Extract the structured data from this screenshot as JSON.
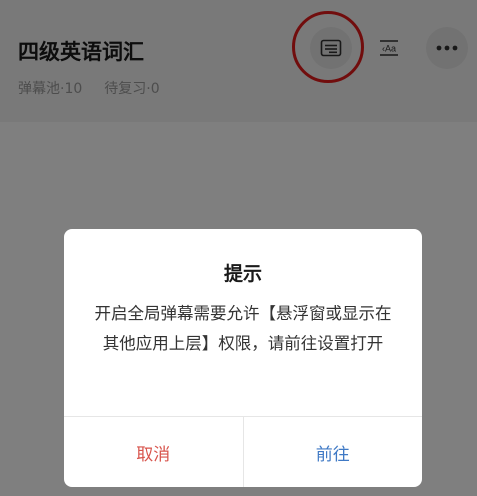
{
  "header": {
    "title": "四级英语词汇",
    "danmaku_pool": "弹幕池·10",
    "review_pending": "待复习·0"
  },
  "icons": {
    "danmaku": "danmaku-icon",
    "translate": "translate-icon",
    "more": "more-icon"
  },
  "annotation": {
    "highlight_color": "#e21a1a"
  },
  "dialog": {
    "title": "提示",
    "message": "开启全局弹幕需要允许【悬浮窗或显示在其他应用上层】权限，请前往设置打开",
    "cancel_label": "取消",
    "confirm_label": "前往",
    "cancel_color": "#d8544c",
    "confirm_color": "#3f79c5"
  }
}
